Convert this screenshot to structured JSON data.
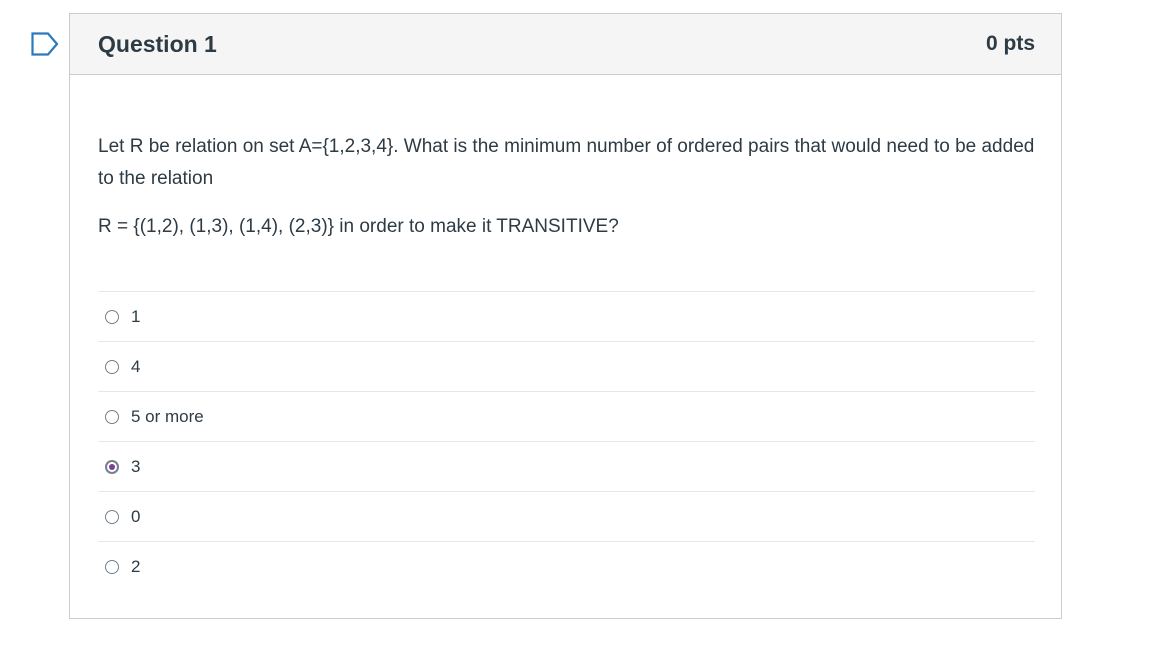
{
  "question": {
    "title": "Question 1",
    "points": "0 pts",
    "text_line1": "Let R be relation on set A={1,2,3,4}. What is the minimum number of ordered pairs that would need to be added to the relation",
    "text_line2": "R = {(1,2), (1,3), (1,4), (2,3)} in order to make it TRANSITIVE?",
    "answers": [
      {
        "label": "1",
        "selected": false
      },
      {
        "label": "4",
        "selected": false
      },
      {
        "label": "5 or more",
        "selected": false
      },
      {
        "label": "3",
        "selected": true
      },
      {
        "label": "0",
        "selected": false
      },
      {
        "label": "2",
        "selected": false
      }
    ]
  },
  "colors": {
    "accent": "#7b3f99",
    "flag": "#2b7abc",
    "header_bg": "#f5f5f5",
    "border": "#c7cdd1"
  },
  "icons": {
    "flag": "flag-question-icon"
  }
}
